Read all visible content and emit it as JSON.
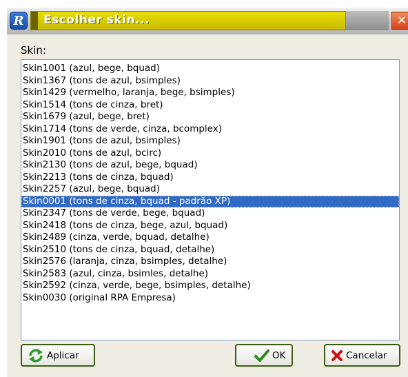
{
  "window": {
    "title": "Escolher skin...",
    "app_icon": "R",
    "close_glyph": "✕"
  },
  "skin_label": "Skin:",
  "skins": [
    "Skin1001 (azul, bege, bquad)",
    "Skin1367 (tons de azul, bsimples)",
    "Skin1429 (vermelho, laranja, bege, bsimples)",
    "Skin1514 (tons de cinza, bret)",
    "Skin1679 (azul, bege, bret)",
    "Skin1714 (tons de verde, cinza, bcomplex)",
    "Skin1901 (tons de azul, bsimples)",
    "Skin2010 (tons de azul, bcirc)",
    "Skin2130 (tons de azul, bege, bquad)",
    "Skin2213 (tons de cinza, bquad)",
    "Skin2257 (azul, bege, bquad)",
    "Skin0001 (tons de cinza, bquad - padrão XP)",
    "Skin2347 (tons de verde, bege, bquad)",
    "Skin2418 (tons de cinza, bege, azul, bquad)",
    "Skin2489 (cinza, verde, bquad, detalhe)",
    "Skin2510 (tons de cinza, bquad, detalhe)",
    "Skin2576 (laranja, cinza, bsimples, detalhe)",
    "Skin2583 (azul, cinza, bsimles, detalhe)",
    "Skin2592 (cinza, verde, bege, bsimples, detalhe)",
    "Skin0030 (original RPA Empresa)"
  ],
  "selected_skin": "Skin0001 (tons de cinza, bquad - padrão XP)",
  "buttons": {
    "apply": "Aplicar",
    "ok": "OK",
    "cancel": "Cancelar"
  },
  "icons": {
    "apply": "refresh-icon",
    "ok": "checkmark-icon",
    "cancel": "x-icon"
  },
  "colors": {
    "title_band": "#d4c800",
    "selection": "#316ac5",
    "close": "#e0502a"
  }
}
